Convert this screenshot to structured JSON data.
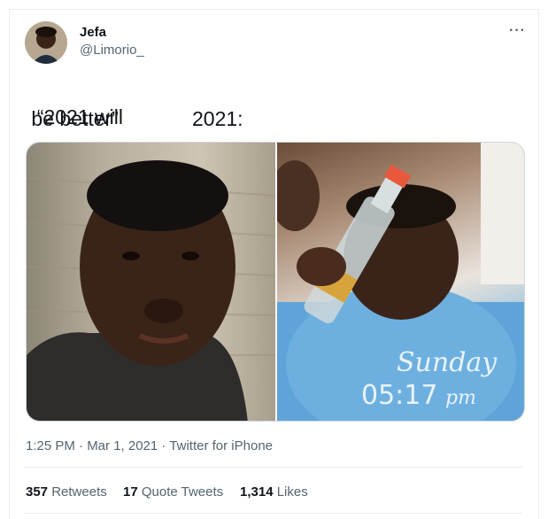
{
  "tweet": {
    "author_name": "Jefa",
    "author_handle": "@Limorio_",
    "text_line1": "“2021 will",
    "text_line2": " be better”",
    "text_line2_caption": "2021:",
    "meta": "1:25 PM · Mar 1, 2021 · Twitter for iPhone",
    "more_icon": "···"
  },
  "media": {
    "watermark_day": "Sunday",
    "watermark_time": "05:17",
    "watermark_ampm": "pm"
  },
  "stats": {
    "retweets_count": "357",
    "retweets_label": "Retweets",
    "quotes_count": "17",
    "quotes_label": "Quote Tweets",
    "likes_count": "1,314",
    "likes_label": "Likes"
  },
  "colors": {
    "text_primary": "#0f1419",
    "text_secondary": "#536471",
    "border": "#e6ecf0"
  }
}
